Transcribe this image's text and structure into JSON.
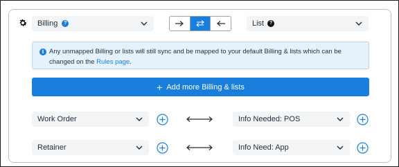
{
  "header": {
    "left_select_label": "Billing",
    "right_select_label": "List"
  },
  "direction": {
    "options": [
      "right-arrow",
      "swap-arrows",
      "left-arrow"
    ],
    "selected": "swap-arrows"
  },
  "info": {
    "text": "Any unmapped Billing or lists will still sync and be mapped to your default Billing & lists which can be changed on the ",
    "link_text": "Rules page",
    "suffix": "."
  },
  "add_button": {
    "label": "Add more Billing & lists"
  },
  "mappings": [
    {
      "left": "Work Order",
      "right": "Info Needed: POS"
    },
    {
      "left": "Retainer",
      "right": "Info Need: App"
    }
  ],
  "colors": {
    "accent": "#1a7fdc",
    "info_bg": "#e6f2fb",
    "select_bg": "#f2f4f6"
  }
}
